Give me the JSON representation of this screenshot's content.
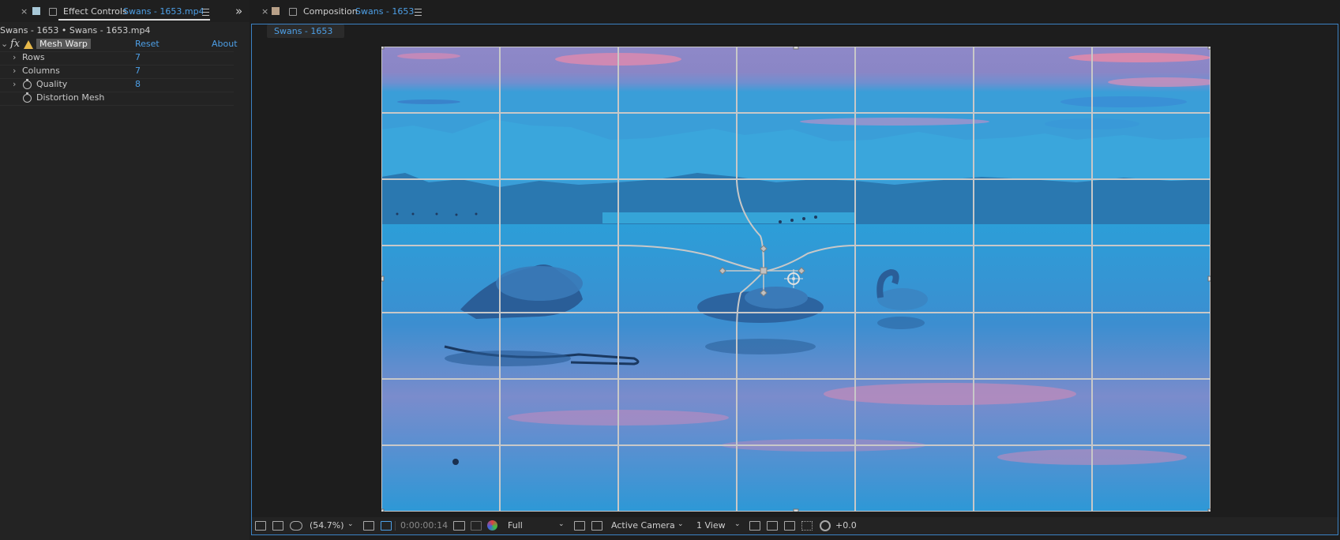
{
  "effect_controls": {
    "close": "×",
    "tab_title": "Effect Controls",
    "tab_file": "Swans - 1653.mp4",
    "expand_glyph": "»",
    "source_path": "Swans - 1653 • Swans - 1653.mp4",
    "effect": {
      "fx_label": "fx",
      "name": "Mesh Warp",
      "reset": "Reset",
      "about": "About"
    },
    "properties": [
      {
        "label": "Rows",
        "value": "7"
      },
      {
        "label": "Columns",
        "value": "7"
      },
      {
        "label": "Quality",
        "value": "8"
      },
      {
        "label": "Distortion Mesh",
        "value": ""
      }
    ],
    "swatch_color": "#a8c8d8"
  },
  "composition": {
    "close": "×",
    "tab_title": "Composition",
    "tab_name": "Swans - 1653",
    "chip": "Swans - 1653",
    "swatch_color": "#b8a088",
    "mesh": {
      "rows": 7,
      "columns": 7
    }
  },
  "viewer_bar": {
    "zoom": "(54.7%)",
    "timecode": "0:00:00:14",
    "resolution": "Full",
    "camera": "Active Camera",
    "views": "1 View",
    "exposure": "+0.0"
  },
  "colors": {
    "accent_blue": "#4d9fe6",
    "warning": "#e6b84a",
    "panel_border": "#3b82c4"
  }
}
